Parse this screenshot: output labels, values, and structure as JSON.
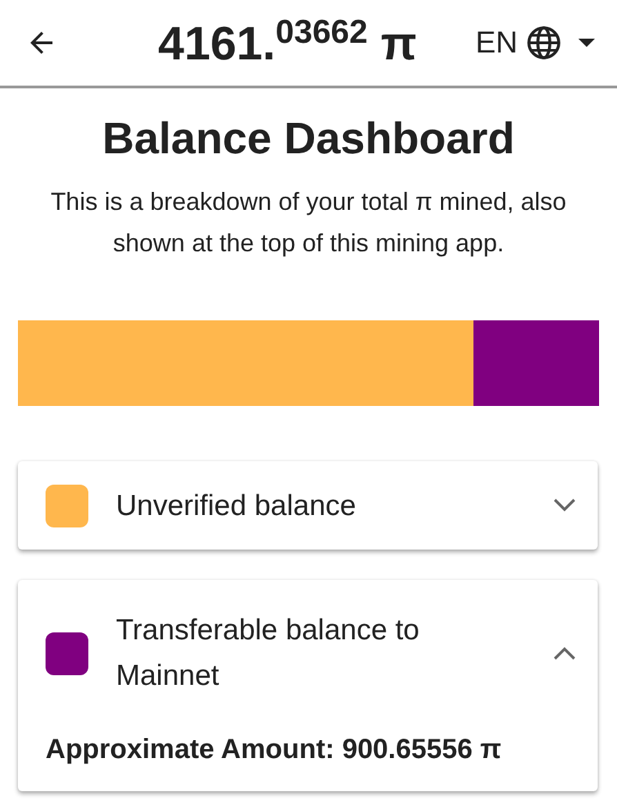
{
  "header": {
    "balance": "4161.$^{03662}$ π",
    "language": "EN"
  },
  "title": "Balance Dashboard",
  "description": "This is a breakdown of your total π mined, also shown at the top of this mining app.",
  "balance_bar": {
    "level": 0.784
  },
  "sections": [
    {
      "color": "#ffb74d",
      "label": "Unverified balance",
      "expanded": false
    },
    {
      "color": "#800080",
      "label": "Transferable balance to Mainnet",
      "expanded": true,
      "detail": "Approximate Amount: 900.65556 π"
    }
  ]
}
